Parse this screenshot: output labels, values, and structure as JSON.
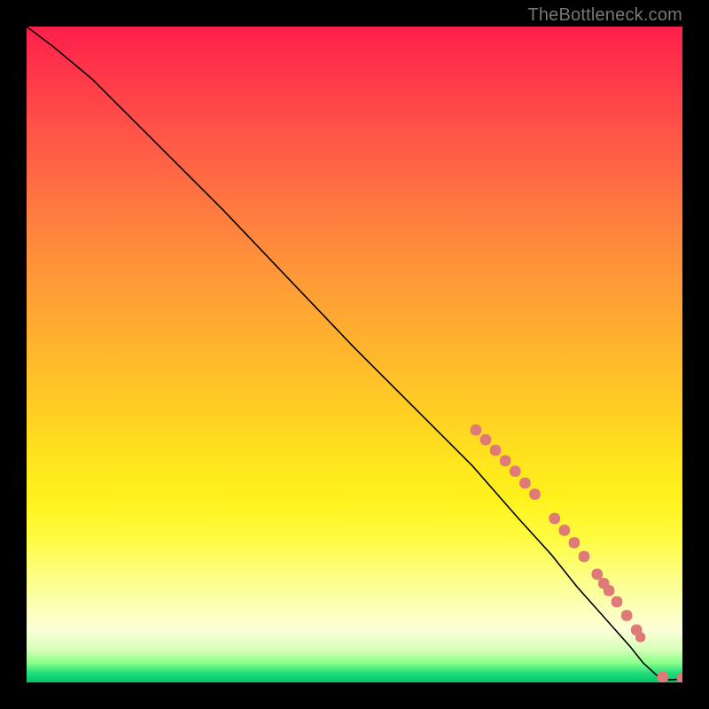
{
  "attribution": "TheBottleneck.com",
  "chart_data": {
    "type": "line",
    "title": "",
    "xlabel": "",
    "ylabel": "",
    "xlim": [
      0,
      100
    ],
    "ylim": [
      0,
      100
    ],
    "grid": false,
    "legend": false,
    "series": [
      {
        "name": "bottleneck-curve",
        "style": "line",
        "x": [
          0,
          4,
          10,
          20,
          30,
          40,
          50,
          60,
          68,
          75,
          80,
          84,
          88,
          92,
          94,
          96.5,
          98,
          100
        ],
        "y": [
          100,
          97,
          92,
          82,
          72,
          61.5,
          51,
          41,
          33,
          25,
          19.5,
          14.5,
          10,
          5.5,
          3,
          0.7,
          0.4,
          0.5
        ]
      },
      {
        "name": "data-points",
        "style": "scatter",
        "points": [
          {
            "x": 68.5,
            "y": 38.5,
            "r": 5.0
          },
          {
            "x": 70.0,
            "y": 37.0,
            "r": 5.0
          },
          {
            "x": 71.5,
            "y": 35.4,
            "r": 5.0
          },
          {
            "x": 73.0,
            "y": 33.8,
            "r": 5.0
          },
          {
            "x": 74.5,
            "y": 32.2,
            "r": 5.0
          },
          {
            "x": 76.0,
            "y": 30.4,
            "r": 5.0
          },
          {
            "x": 77.5,
            "y": 28.7,
            "r": 5.0
          },
          {
            "x": 80.5,
            "y": 25.0,
            "r": 5.0
          },
          {
            "x": 82.0,
            "y": 23.2,
            "r": 5.0
          },
          {
            "x": 83.5,
            "y": 21.3,
            "r": 5.0
          },
          {
            "x": 85.0,
            "y": 19.2,
            "r": 5.0
          },
          {
            "x": 87.0,
            "y": 16.5,
            "r": 5.0
          },
          {
            "x": 88.0,
            "y": 15.1,
            "r": 5.0
          },
          {
            "x": 88.8,
            "y": 14.0,
            "r": 5.0
          },
          {
            "x": 90.0,
            "y": 12.3,
            "r": 5.0
          },
          {
            "x": 91.5,
            "y": 10.2,
            "r": 5.0
          },
          {
            "x": 93.0,
            "y": 8.0,
            "r": 5.0
          },
          {
            "x": 93.6,
            "y": 6.9,
            "r": 4.5
          },
          {
            "x": 97.0,
            "y": 0.8,
            "r": 5.0
          },
          {
            "x": 100.0,
            "y": 0.6,
            "r": 5.0
          }
        ]
      }
    ],
    "background_gradient": {
      "direction": "top-to-bottom",
      "stops": [
        {
          "pos": 0.0,
          "color": "#ff1f4b"
        },
        {
          "pos": 0.38,
          "color": "#ff9838"
        },
        {
          "pos": 0.66,
          "color": "#ffe41e"
        },
        {
          "pos": 0.88,
          "color": "#fcffb0"
        },
        {
          "pos": 0.97,
          "color": "#8cff8c"
        },
        {
          "pos": 1.0,
          "color": "#00c26a"
        }
      ]
    }
  }
}
